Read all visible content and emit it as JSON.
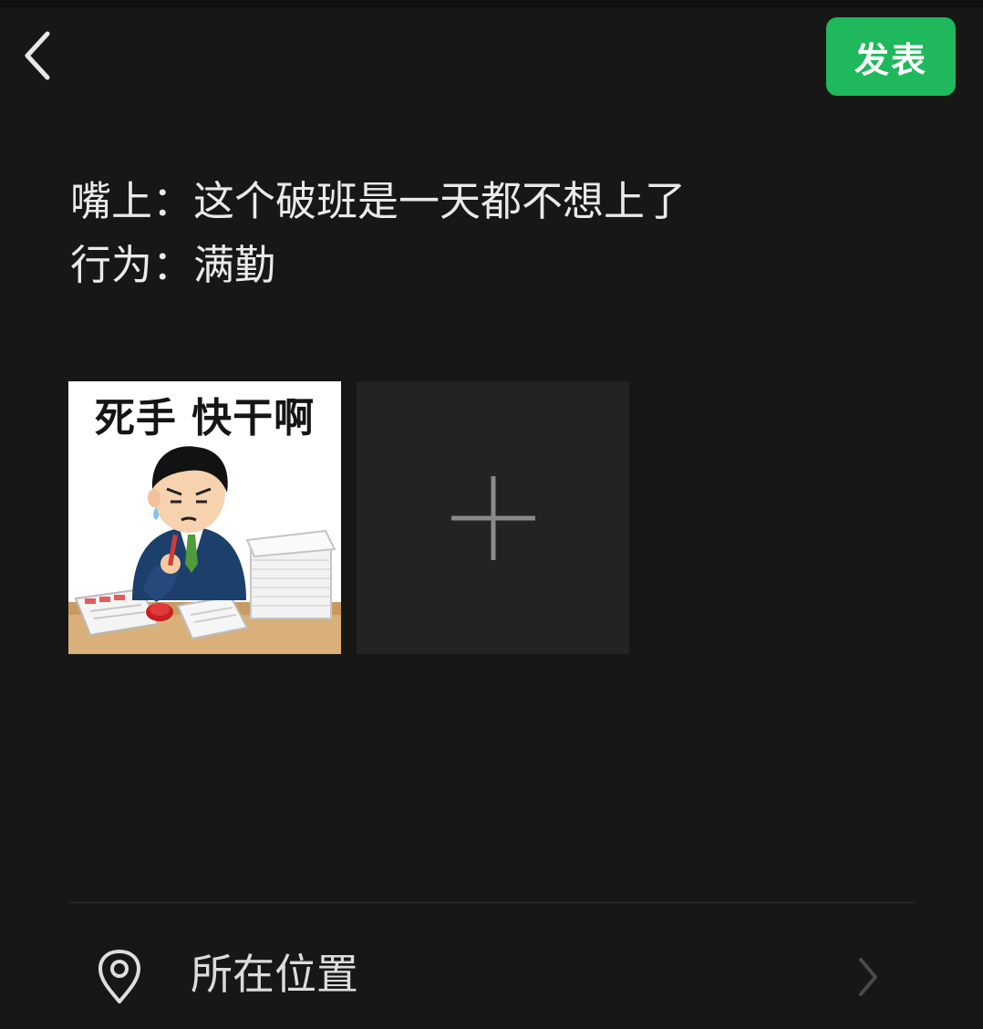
{
  "header": {
    "back_icon": "chevron-left-icon",
    "publish_label": "发表",
    "publish_color": "#1fb85c"
  },
  "post": {
    "lines": [
      "嘴上：这个破班是一天都不想上了",
      "行为：满勤"
    ]
  },
  "media": {
    "images": [
      {
        "caption": "死手 快干啊"
      }
    ],
    "add_icon": "plus-icon"
  },
  "location": {
    "icon": "location-pin-icon",
    "label": "所在位置",
    "chevron_icon": "chevron-right-icon"
  },
  "theme": {
    "background": "#171717",
    "text": "#eaeaea",
    "tile": "#232323"
  }
}
